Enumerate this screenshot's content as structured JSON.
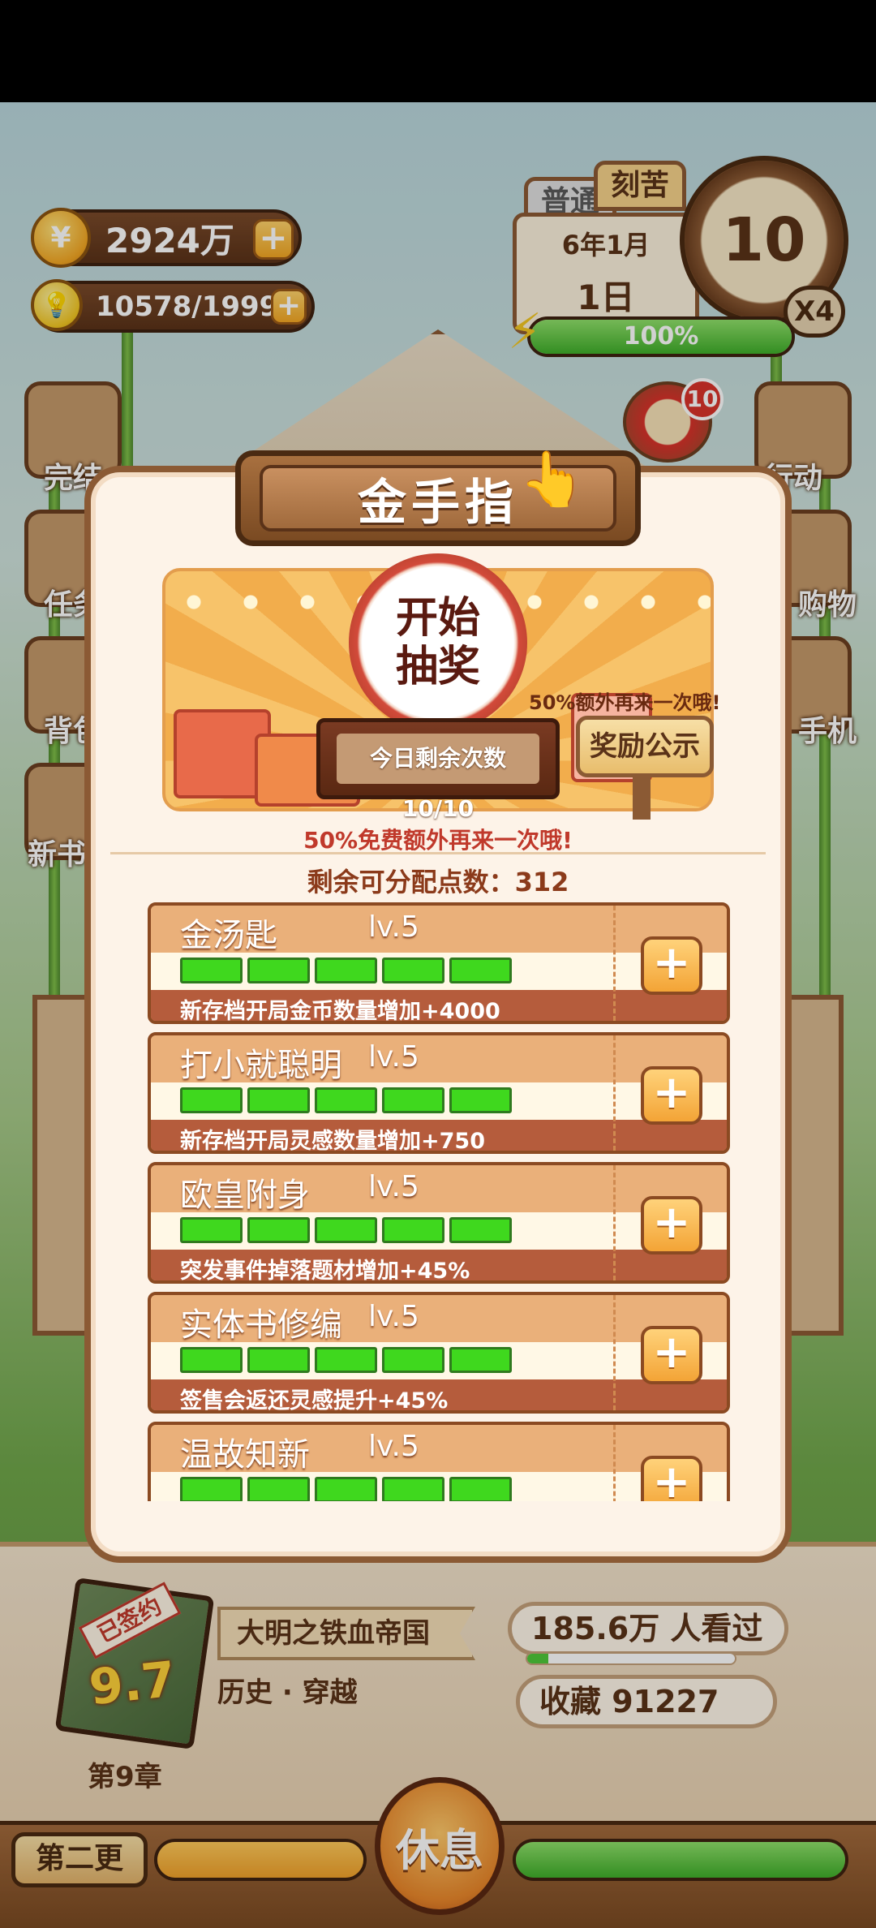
{
  "hud": {
    "coins": "2924万",
    "inspiration": "10578/19999",
    "tags": [
      "普通",
      "刻苦"
    ],
    "calendar_month": "6年1月",
    "calendar_day": "1日",
    "time": "10",
    "speed": "X4",
    "energy_text": "100%",
    "energy_fraction": 1.0,
    "notification_count": "10"
  },
  "side_menu": {
    "left": [
      "完结",
      "任务",
      "背包",
      "新书"
    ],
    "right": [
      "行动",
      "购物",
      "手机"
    ]
  },
  "modal": {
    "title": "金手指",
    "lottery_button": "开始抽奖",
    "extra_chance_small": "50%额外再来一次哦!",
    "reward_notice_button": "奖励公示",
    "remaining_today": "今日剩余次数10/10",
    "free_extra_line": "50%免费额外再来一次哦!",
    "points_label": "剩余可分配点数：312",
    "skills": [
      {
        "name": "金汤匙",
        "level": "lv.5",
        "desc": "新存档开局金币数量增加+4000",
        "filled": 5
      },
      {
        "name": "打小就聪明",
        "level": "lv.5",
        "desc": "新存档开局灵感数量增加+750",
        "filled": 5
      },
      {
        "name": "欧皇附身",
        "level": "lv.5",
        "desc": "突发事件掉落题材增加+45%",
        "filled": 5
      },
      {
        "name": "实体书修编",
        "level": "lv.5",
        "desc": "签售会返还灵感提升+45%",
        "filled": 5
      },
      {
        "name": "温故知新",
        "level": "lv.5",
        "desc": "",
        "filled": 5
      }
    ]
  },
  "book": {
    "signed_badge": "已签约",
    "score": "9.7",
    "title": "大明之铁血帝国",
    "genre": "历史 · 穿越",
    "chapter": "第9章",
    "views": "185.6万 人看过",
    "views_fraction": 0.1,
    "favorites": "收藏 91227"
  },
  "bottom": {
    "second_update": "第二更",
    "rest_button": "休息",
    "left_progress": 1.0,
    "right_progress": 1.0
  },
  "colors": {
    "accent_brown": "#8b5a34",
    "panel_cream": "#fdf3e8",
    "bar_green": "#3fd81e",
    "red_text": "#c0392b"
  }
}
